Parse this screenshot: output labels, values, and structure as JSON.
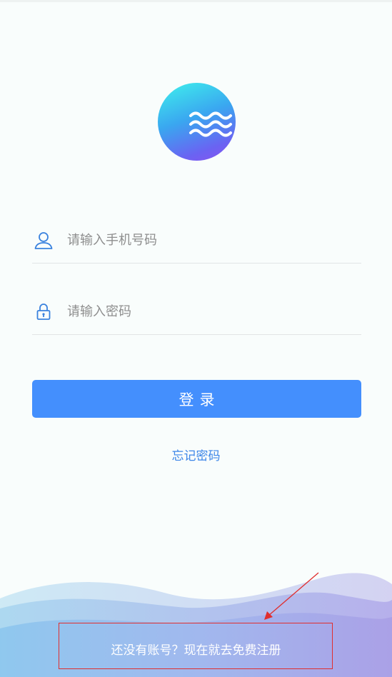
{
  "login": {
    "phone_placeholder": "请输入手机号码",
    "password_placeholder": "请输入密码",
    "login_button": "登录",
    "forgot_password": "忘记密码",
    "register_prompt": "还没有账号？现在就去免费注册"
  },
  "icons": {
    "logo": "wave-logo-icon",
    "phone": "user-icon",
    "password": "lock-icon"
  },
  "colors": {
    "primary": "#448ffd",
    "link": "#3d86e8",
    "annotation": "#e02e2e",
    "background": "#f9fdfc"
  }
}
